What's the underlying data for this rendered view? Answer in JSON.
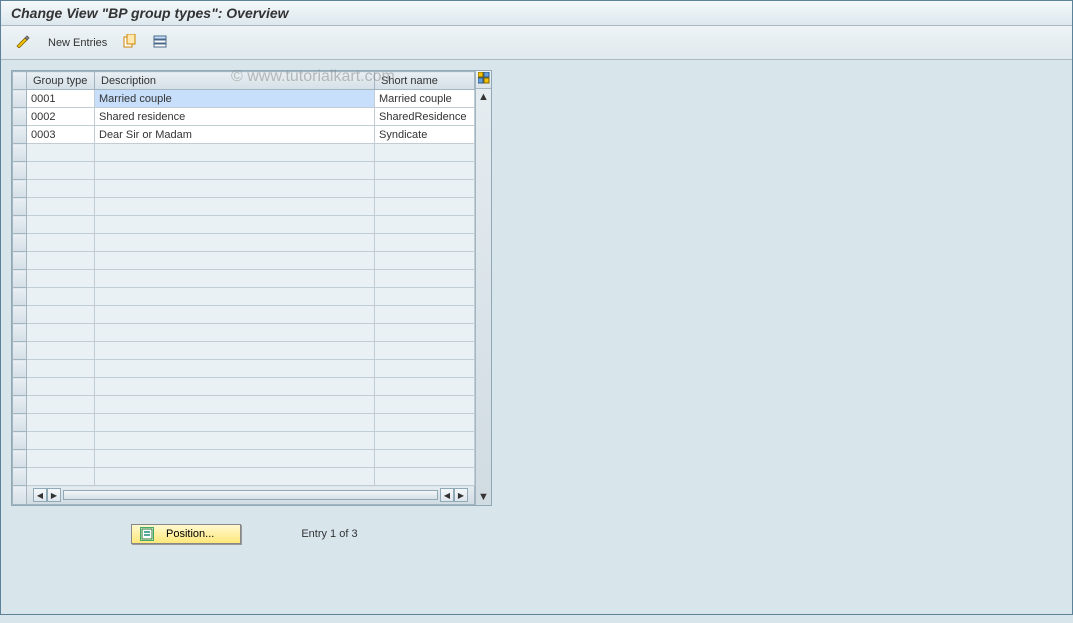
{
  "title": "Change View \"BP group types\": Overview",
  "watermark": "© www.tutorialkart.com",
  "toolbar": {
    "new_entries_label": "New Entries"
  },
  "columns": {
    "group_type": "Group type",
    "description": "Description",
    "short_name": "Short name"
  },
  "rows": [
    {
      "group": "0001",
      "desc": "Married couple",
      "short": "Married couple",
      "selected": true
    },
    {
      "group": "0002",
      "desc": "Shared residence",
      "short": "SharedResidence",
      "selected": false
    },
    {
      "group": "0003",
      "desc": "Dear Sir or Madam",
      "short": "Syndicate",
      "selected": false
    }
  ],
  "empty_row_count": 19,
  "footer": {
    "position_label": "Position...",
    "status": "Entry 1 of 3"
  }
}
